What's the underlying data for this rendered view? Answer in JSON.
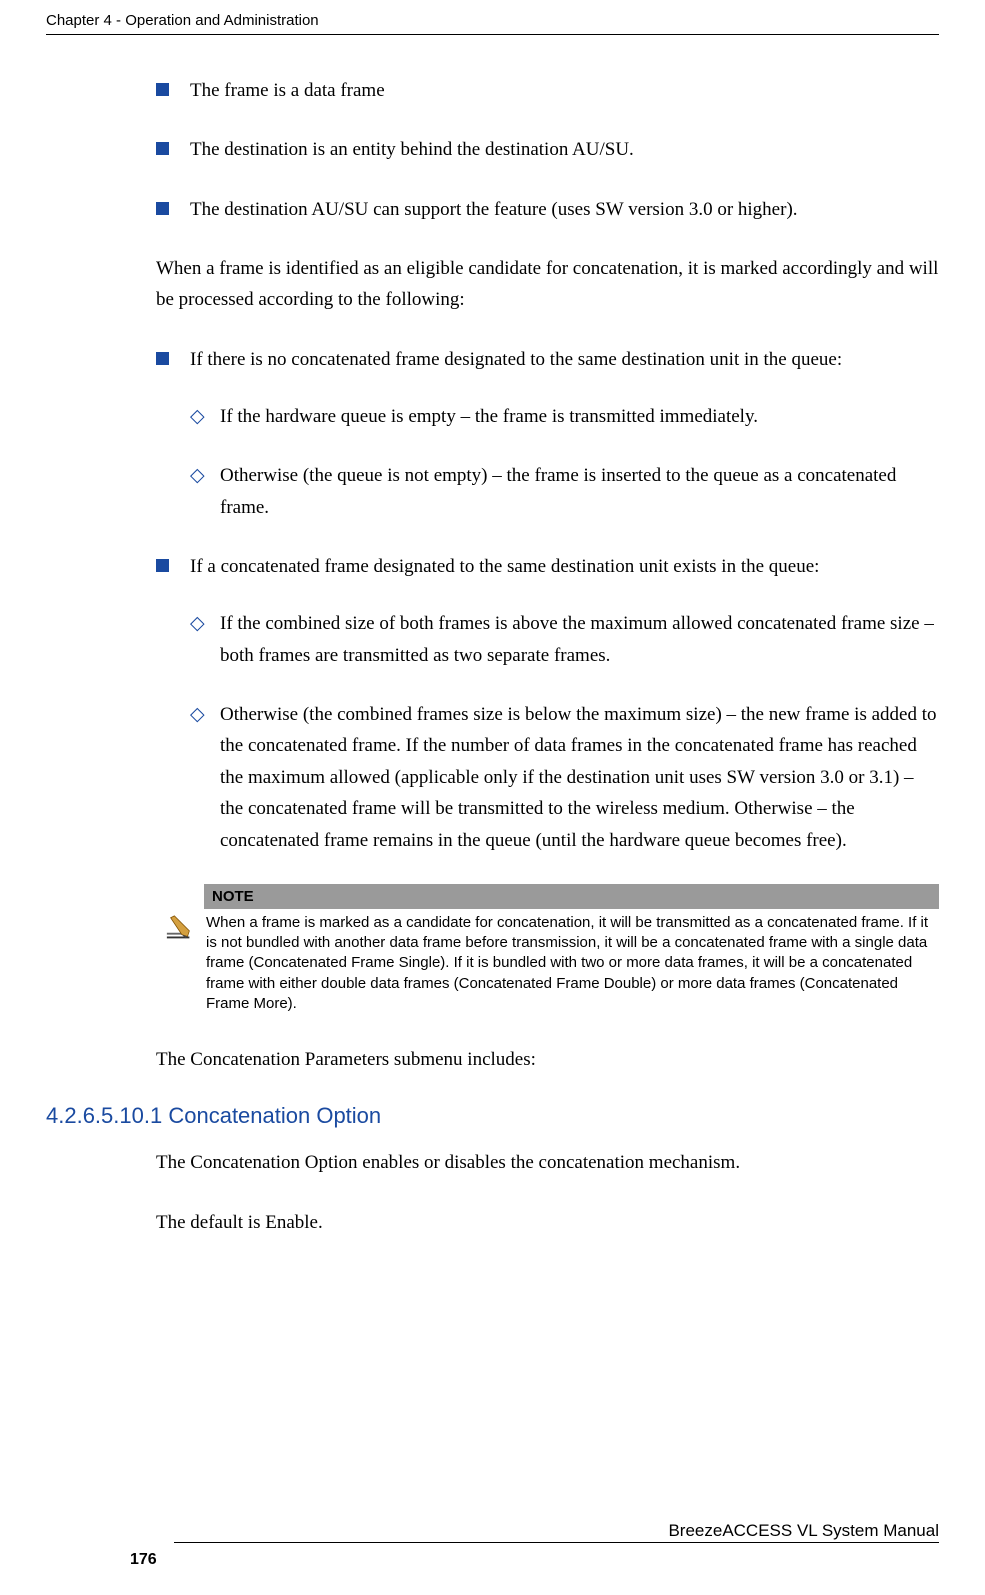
{
  "header": {
    "chapter": "Chapter 4 - Operation and Administration"
  },
  "bullets_top": [
    "The frame is a data frame",
    "The destination is an entity behind the destination AU/SU.",
    "The destination AU/SU can support the feature (uses SW version 3.0 or higher)."
  ],
  "para1": "When a frame is identified as an eligible candidate for concatenation, it is marked accordingly and will be processed according to the following:",
  "bullets_mid": [
    {
      "text": "If there is no concatenated frame designated to the same destination unit in the queue:",
      "subs": [
        "If the hardware queue is empty – the frame is transmitted immediately.",
        "Otherwise (the queue is not empty) – the frame is inserted to the queue as a concatenated frame."
      ]
    },
    {
      "text": "If a concatenated frame designated to the same destination unit exists in the queue:",
      "subs": [
        "If the combined size of both frames is above the maximum allowed concatenated frame size – both frames are transmitted as two separate frames.",
        "Otherwise (the combined frames size is below the maximum size) – the new frame is added to the concatenated frame. If the number of data frames in the concatenated frame has reached the maximum allowed (applicable only if the destination unit uses SW version 3.0 or 3.1) – the concatenated frame will be transmitted to the wireless medium. Otherwise – the concatenated frame remains in the queue (until the hardware queue becomes free)."
      ]
    }
  ],
  "note": {
    "label": "NOTE",
    "body": "When a frame is marked as a candidate for concatenation, it will be transmitted as a concatenated frame. If it is not bundled with another data frame before transmission, it will be a concatenated frame with a single data frame (Concatenated Frame Single). If it is bundled with two or more data frames, it will be a concatenated frame with either double data frames (Concatenated Frame Double) or more data frames (Concatenated Frame More)."
  },
  "para2": "The Concatenation Parameters submenu includes:",
  "section": {
    "number": "4.2.6.5.10.1",
    "title": "Concatenation Option"
  },
  "para3": "The Concatenation Option enables or disables the concatenation mechanism.",
  "para4": "The default is Enable.",
  "footer": {
    "page": "176",
    "manual": "BreezeACCESS VL System Manual"
  }
}
